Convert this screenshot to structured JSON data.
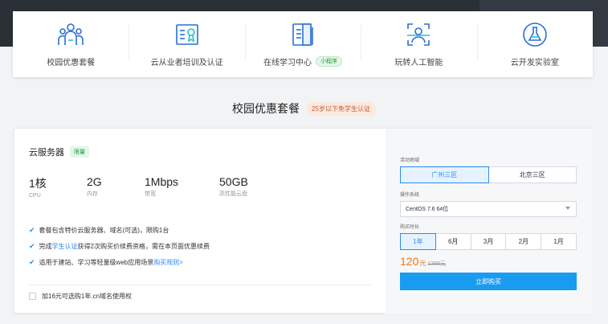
{
  "nav": {
    "items": [
      {
        "label": "校园优惠套餐",
        "icon": "users-icon"
      },
      {
        "label": "云从业者培训及认证",
        "icon": "certificate-icon"
      },
      {
        "label": "在线学习中心",
        "icon": "book-icon",
        "badge": "小程序"
      },
      {
        "label": "玩转人工智能",
        "icon": "face-scan-icon"
      },
      {
        "label": "云开发实验室",
        "icon": "flask-icon"
      }
    ]
  },
  "section": {
    "title": "校园优惠套餐",
    "badge": "25岁以下免学生认证"
  },
  "product": {
    "title": "云服务器",
    "tag": "限量",
    "specs": [
      {
        "value": "1核",
        "label": "CPU"
      },
      {
        "value": "2G",
        "label": "内存"
      },
      {
        "value": "1Mbps",
        "label": "带宽"
      },
      {
        "value": "50GB",
        "label": "高性能云盘"
      }
    ],
    "features": {
      "f1": "套餐包含特价云服务器、域名(可选)，限购1台",
      "f2_pre": "完成",
      "f2_link": "学生认证",
      "f2_post": "获得2次购买价续费资格，需在本页面优惠续费",
      "f3_pre": "适用于建站、学习等轻量级web应用场景",
      "f3_link": "购买规则>"
    },
    "addon": "加16元可选购1年.cn域名使用权"
  },
  "purchase": {
    "region_label": "活动地域",
    "regions": [
      "广州三区",
      "北京三区"
    ],
    "os_label": "操作系统",
    "os_value": "CentOS 7.6 64位",
    "duration_label": "购买时长",
    "durations": [
      "1年",
      "6月",
      "3月",
      "2月",
      "1月"
    ],
    "price": "120",
    "price_unit": "元",
    "price_old": "1398元",
    "buy_label": "立即购买"
  },
  "colors": {
    "accent": "#2a8bf2",
    "price": "#f0760f",
    "buy": "#1a9bf2",
    "tag_green": "#17a34a"
  }
}
